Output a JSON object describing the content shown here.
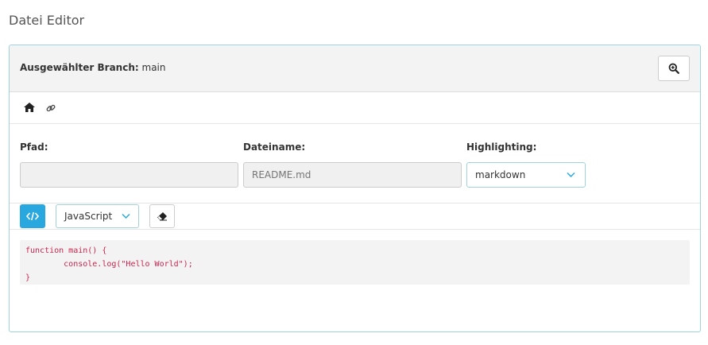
{
  "page": {
    "title": "Datei Editor"
  },
  "header": {
    "branch_label": "Ausgewählter Branch:",
    "branch_value": "main",
    "zoom_icon": "search-plus-icon"
  },
  "nav": {
    "home_icon": "home-icon",
    "link_icon": "link-icon"
  },
  "form": {
    "path": {
      "label": "Pfad:",
      "value": "",
      "placeholder": ""
    },
    "filename": {
      "label": "Dateiname:",
      "value": "",
      "placeholder": "README.md"
    },
    "highlighting": {
      "label": "Highlighting:",
      "value": "markdown"
    }
  },
  "toolbar": {
    "code_icon": "code-icon",
    "language": "JavaScript",
    "eraser_icon": "eraser-icon"
  },
  "editor": {
    "lines": [
      "function main() {",
      "        console.log(\"Hello World\");",
      "}"
    ]
  },
  "colors": {
    "accent": "#29a8e0",
    "border": "#9fd3e0",
    "code_text": "#c7254e"
  }
}
